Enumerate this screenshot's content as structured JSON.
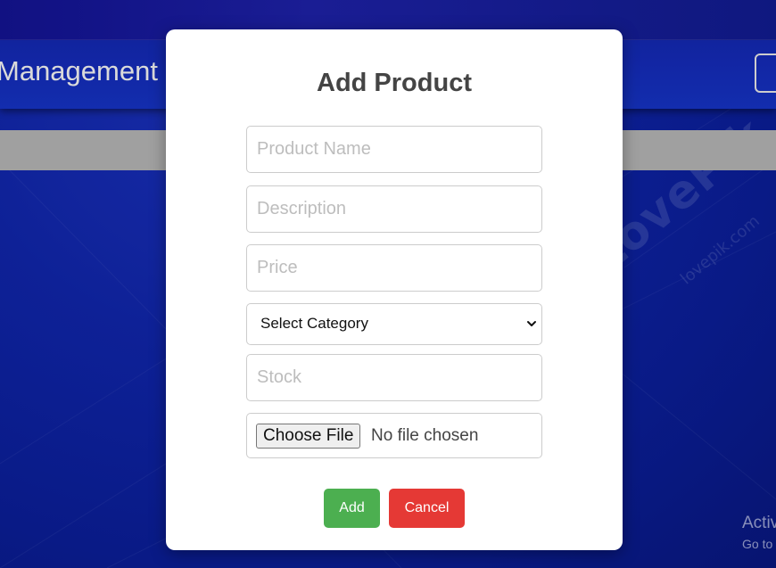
{
  "header": {
    "title": "Management"
  },
  "watermark": {
    "main": "LovePik",
    "sub": "lovepik.com"
  },
  "activation": {
    "line1": "Activ",
    "line2": "Go to"
  },
  "modal": {
    "title": "Add Product",
    "fields": {
      "product_name": {
        "placeholder": "Product Name",
        "value": ""
      },
      "description": {
        "placeholder": "Description",
        "value": ""
      },
      "price": {
        "placeholder": "Price",
        "value": ""
      },
      "stock": {
        "placeholder": "Stock",
        "value": ""
      }
    },
    "category": {
      "selected": "Select Category"
    },
    "file": {
      "button_label": "Choose File",
      "status": "No file chosen"
    },
    "buttons": {
      "add": "Add",
      "cancel": "Cancel"
    }
  },
  "colors": {
    "background": "#0f23a0",
    "add_button": "#4caf50",
    "cancel_button": "#e53935",
    "gray_bar": "#a9a9a9"
  },
  "icons": {
    "select_arrow": "chevron-down-icon"
  }
}
